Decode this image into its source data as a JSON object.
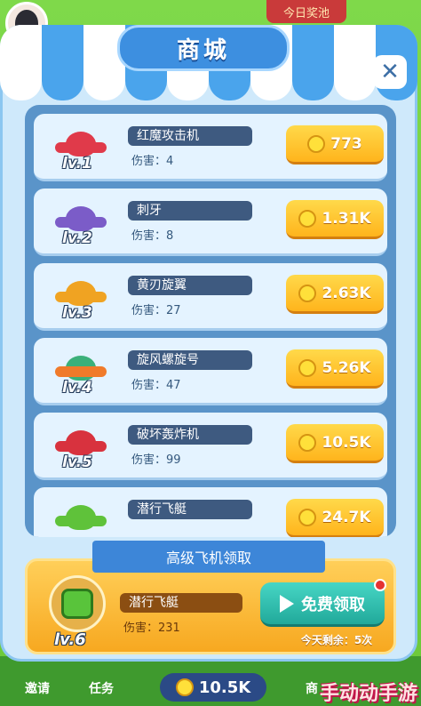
{
  "header": {
    "pool_label": "今日奖池"
  },
  "dialog": {
    "title": "商城",
    "close_glyph": "✕"
  },
  "shop_items": [
    {
      "level": "lv.1",
      "name": "红魔攻击机",
      "damage": "伤害：4",
      "price": "773",
      "color": "#e03a4a"
    },
    {
      "level": "lv.2",
      "name": "刺牙",
      "damage": "伤害：8",
      "price": "1.31K",
      "color": "#7b5cc8"
    },
    {
      "level": "lv.3",
      "name": "黄刃旋翼",
      "damage": "伤害：27",
      "price": "2.63K",
      "color": "#f0a322"
    },
    {
      "level": "lv.4",
      "name": "旋风螺旋号",
      "damage": "伤害：47",
      "price": "5.26K",
      "color": "#f07a2a"
    },
    {
      "level": "lv.5",
      "name": "破坏轰炸机",
      "damage": "伤害：99",
      "price": "10.5K",
      "color": "#d8323e"
    },
    {
      "level": "lv.6",
      "name": "潜行飞艇",
      "damage": "",
      "price": "24.7K",
      "color": "#5fc23a"
    }
  ],
  "free_offer": {
    "ribbon": "高级飞机领取",
    "level": "lv.6",
    "name": "潜行飞艇",
    "damage": "伤害：231",
    "button_label": "免费领取",
    "remaining": "今天剩余：5次"
  },
  "bottom_bar": {
    "invite": "邀请",
    "task": "任务",
    "coins": "10.5K",
    "shop": "商",
    "watermark": "手动动手游"
  }
}
